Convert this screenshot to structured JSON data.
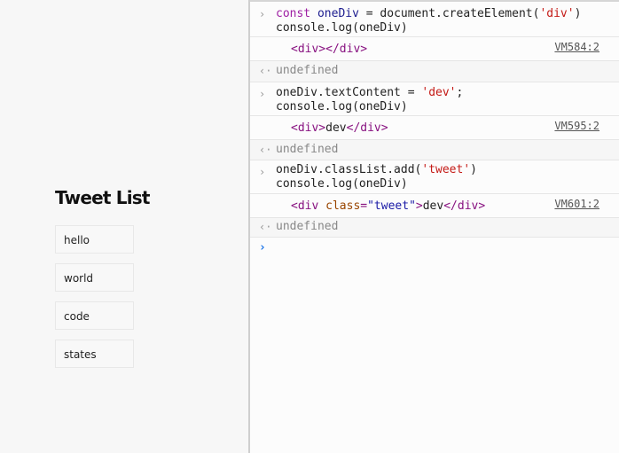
{
  "page": {
    "title": "Tweet List",
    "tweets": [
      "hello",
      "world",
      "code",
      "states"
    ]
  },
  "console": {
    "entries": [
      {
        "input": {
          "line1": {
            "kw": "const",
            "var": "oneDiv",
            "eq": " = document.createElement(",
            "str": "'div'",
            "end": ")"
          },
          "line2": "console.log(oneDiv)"
        },
        "log": {
          "open": "<div>",
          "text": "",
          "close": "</div>",
          "source": "VM584:2"
        },
        "result": "undefined"
      },
      {
        "input": {
          "line1": {
            "pre": "oneDiv.textContent = ",
            "str": "'dev'",
            "end": ";"
          },
          "line2": "console.log(oneDiv)"
        },
        "log": {
          "open": "<div>",
          "text": "dev",
          "close": "</div>",
          "source": "VM595:2"
        },
        "result": "undefined"
      },
      {
        "input": {
          "line1": {
            "pre": "oneDiv.classList.add(",
            "str": "'tweet'",
            "end": ")"
          },
          "line2": "console.log(oneDiv)"
        },
        "log": {
          "tag_start": "<div ",
          "attr": "class",
          "eq": "=",
          "attrval": "\"tweet\"",
          "gt": ">",
          "text": "dev",
          "close": "</div>",
          "source": "VM601:2"
        },
        "result": "undefined"
      }
    ],
    "icons": {
      "input_chevron": "chevron-right-icon",
      "result_arrow": "return-arrow-icon",
      "prompt": "prompt-chevron-icon"
    },
    "glyphs": {
      "input": "›",
      "result": "‹·",
      "prompt": "›"
    }
  }
}
